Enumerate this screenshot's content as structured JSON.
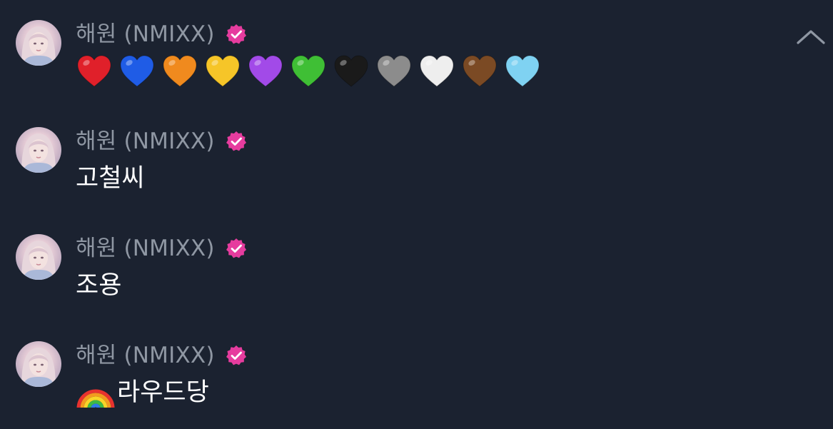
{
  "controls": {
    "collapse_icon": "chevron-up-icon"
  },
  "author": {
    "name": "해원 (NMIXX)",
    "verified_color": "#e63c9e"
  },
  "messages": [
    {
      "type": "emoji",
      "emoji": [
        "❤️",
        "💙",
        "🧡",
        "💛",
        "💜",
        "💚",
        "🖤",
        "🩶",
        "🤍",
        "🤎",
        "🩵"
      ],
      "heart_colors": [
        "#e0202a",
        "#1f5ce6",
        "#f08a1e",
        "#f6c528",
        "#a24ae8",
        "#3fbf35",
        "#1a1a1a",
        "#8c8c8c",
        "#eeeeee",
        "#7b4a24",
        "#7fd2f2"
      ]
    },
    {
      "type": "text",
      "text": "고철씨"
    },
    {
      "type": "text",
      "text": "조용"
    },
    {
      "type": "text-emoji",
      "emoji": "🌈",
      "text": "라우드당"
    }
  ]
}
